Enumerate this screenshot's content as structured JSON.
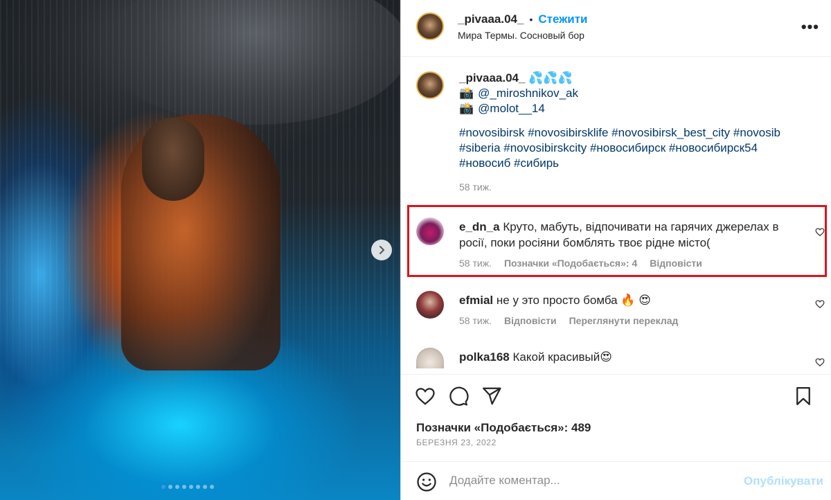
{
  "header": {
    "username": "_pivaaa.04_",
    "separator": "•",
    "follow": "Стежити",
    "location": "Мира Термы. Сосновый бор",
    "more": "•••"
  },
  "caption": {
    "username": "_pivaaa.04_",
    "emoji": "💦💦💦",
    "credit1_icon": "📸",
    "credit1": "@_miroshnikov_ak",
    "credit2_icon": "📸",
    "credit2": "@molot__14",
    "tags_line1": "#novosibirsk #novosibirsklife #novosibirsk_best_city #novosib",
    "tags_line2": "#siberia #novosibirskcity #новосибирск #новосибирск54",
    "tags_line3": "#новосиб #сибирь",
    "time": "58 тиж."
  },
  "comments": [
    {
      "username": "e_dn_a",
      "text_line1": "Круто, мабуть, відпочивати на гарячих джерелах в",
      "text_line2": "росії, поки росіяни бомблять твоє рідне місто(",
      "time": "58 тиж.",
      "likes": "Позначки «Подобається»: 4",
      "reply": "Відповісти"
    },
    {
      "username": "efmial",
      "text": "не у это просто бомба 🔥 😍",
      "time": "58 тиж.",
      "reply": "Відповісти",
      "translate": "Переглянути переклад"
    },
    {
      "username": "polka168",
      "text": "Какой красивый😍"
    }
  ],
  "actions": {
    "likes": "Позначки «Подобається»: 489",
    "date": "БЕРЕЗНЯ 23, 2022"
  },
  "add_comment": {
    "placeholder": "Додайте коментар...",
    "post": "Опублікувати"
  },
  "colors": {
    "link": "#00376b",
    "follow": "#0095f6",
    "highlight": "#e2101a",
    "muted": "#8e8e8e"
  },
  "carousel": {
    "total": 8,
    "active": 1
  }
}
